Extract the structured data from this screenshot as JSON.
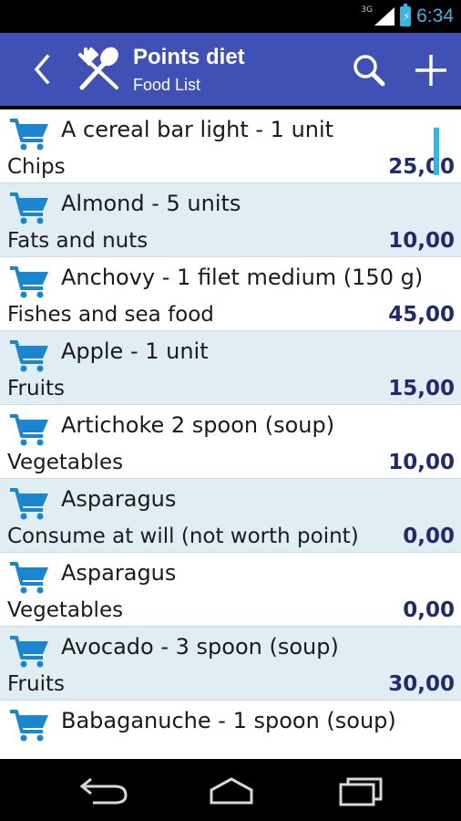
{
  "status_bar": {
    "network": "3G",
    "time": "6:34"
  },
  "action_bar": {
    "title": "Points diet",
    "subtitle": "Food List"
  },
  "icons": {
    "back": "back-arrow-icon",
    "app": "fork-spoon-icon",
    "search": "search-icon",
    "add": "plus-icon",
    "cart": "shopping-cart-icon"
  },
  "colors": {
    "action_bar": "#3f51b5",
    "row_alt": "#e0eef4",
    "cart_icon": "#1a86d0",
    "points": "#202a6e",
    "accent": "#33b5e5"
  },
  "items": [
    {
      "name": "A cereal bar light - 1 unit",
      "category": "Chips",
      "points": "25,00"
    },
    {
      "name": "Almond - 5 units",
      "category": "Fats and nuts",
      "points": "10,00"
    },
    {
      "name": "Anchovy - 1 filet medium (150 g)",
      "category": "Fishes and sea food",
      "points": "45,00"
    },
    {
      "name": "Apple - 1 unit",
      "category": "Fruits",
      "points": "15,00"
    },
    {
      "name": "Artichoke 2 spoon (soup)",
      "category": "Vegetables",
      "points": "10,00"
    },
    {
      "name": "Asparagus",
      "category": "Consume at will (not worth point)",
      "points": "0,00"
    },
    {
      "name": "Asparagus",
      "category": "Vegetables",
      "points": "0,00"
    },
    {
      "name": "Avocado - 3 spoon (soup)",
      "category": "Fruits",
      "points": "30,00"
    },
    {
      "name": "Babaganuche - 1 spoon (soup)",
      "category": "",
      "points": ""
    }
  ]
}
